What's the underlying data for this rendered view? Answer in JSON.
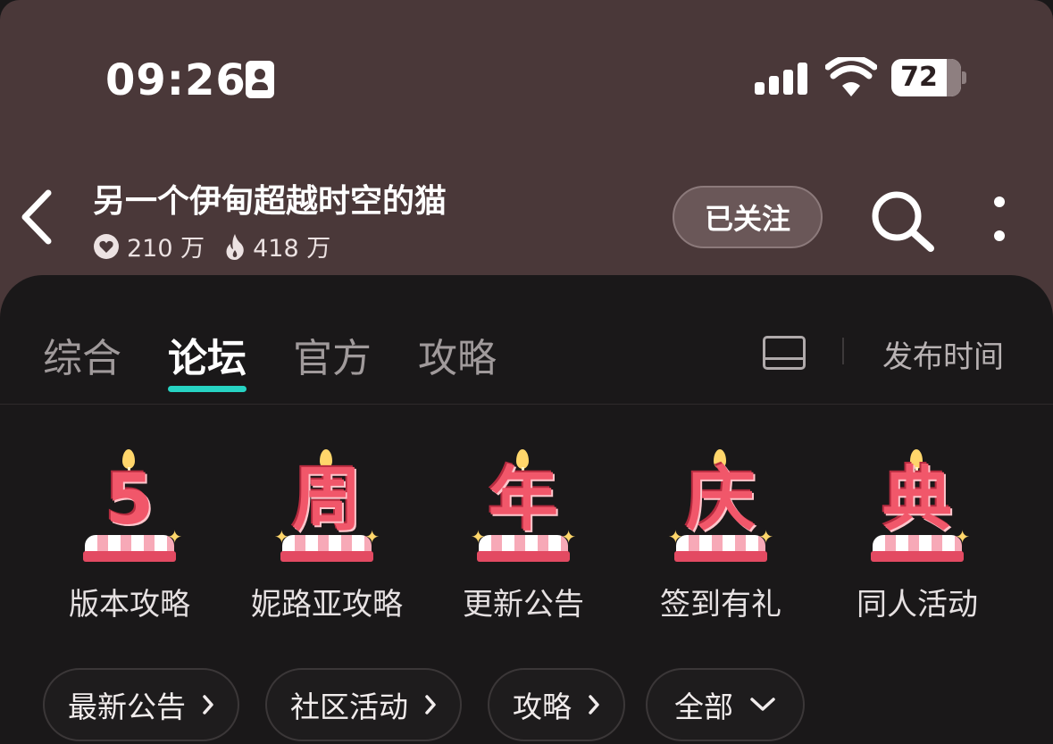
{
  "status_bar": {
    "time": "09:26",
    "battery": "72"
  },
  "header": {
    "title": "另一个伊甸超越时空的猫",
    "likes": "210 万",
    "heat": "418 万",
    "follow_label": "已关注"
  },
  "tabs": [
    {
      "label": "综合",
      "active": false
    },
    {
      "label": "论坛",
      "active": true
    },
    {
      "label": "官方",
      "active": false
    },
    {
      "label": "攻略",
      "active": false
    }
  ],
  "sort_label": "发布时间",
  "shortcuts": [
    {
      "glyph": "5",
      "label": "版本攻略"
    },
    {
      "glyph": "周",
      "label": "妮路亚攻略"
    },
    {
      "glyph": "年",
      "label": "更新公告"
    },
    {
      "glyph": "庆",
      "label": "签到有礼"
    },
    {
      "glyph": "典",
      "label": "同人活动"
    }
  ],
  "chips": [
    {
      "label": "最新公告",
      "icon": "chevron-right-icon"
    },
    {
      "label": "社区活动",
      "icon": "chevron-right-icon"
    },
    {
      "label": "攻略",
      "icon": "chevron-right-icon"
    },
    {
      "label": "全部",
      "icon": "chevron-down-icon"
    }
  ],
  "colors": {
    "header_bg": "#4a3839",
    "panel_bg": "#1a1819",
    "tab_indicator": "#27d3c3",
    "cake_glyph": "#f1576a"
  }
}
